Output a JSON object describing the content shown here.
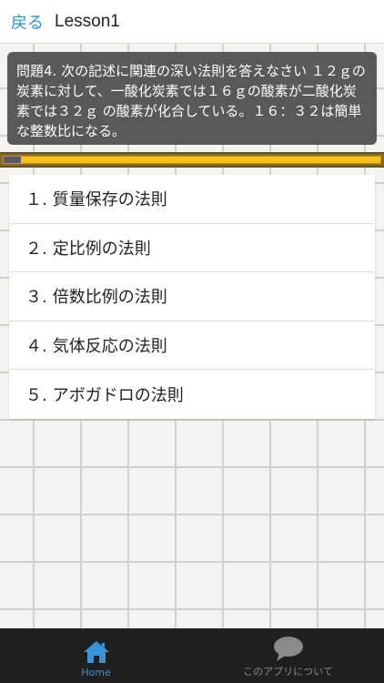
{
  "header": {
    "back_label": "戻る",
    "title": "Lesson1"
  },
  "question": {
    "text": "問題4. 次の記述に関連の深い法則を答えなさい １２ｇの炭素に対して、一酸化炭素では１６ｇの酸素が二酸化炭素では３２ｇ の酸素が化合している。１６：３２は簡単な整数比になる。"
  },
  "progress": {
    "fraction": 0.045,
    "fill_color": "#f6c21a",
    "done_color": "#5a5a5a"
  },
  "choices": [
    {
      "num": "１.",
      "label": "質量保存の法則"
    },
    {
      "num": "２.",
      "label": "定比例の法則"
    },
    {
      "num": "３.",
      "label": "倍数比例の法則"
    },
    {
      "num": "４.",
      "label": "気体反応の法則"
    },
    {
      "num": "５.",
      "label": "アボガドロの法則"
    }
  ],
  "tabbar": {
    "home": {
      "label": "Home",
      "icon": "home-icon"
    },
    "about": {
      "label": "このアプリについて",
      "icon": "speech-bubble-icon"
    }
  },
  "colors": {
    "accent": "#2e8fd6",
    "tab_active": "#3a93d8"
  }
}
